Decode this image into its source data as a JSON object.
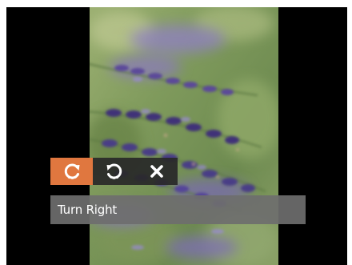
{
  "toolbar": {
    "buttons": [
      {
        "icon": "rotate-right-icon",
        "selected": true
      },
      {
        "icon": "rotate-left-icon",
        "selected": false
      },
      {
        "icon": "close-icon",
        "selected": false
      }
    ]
  },
  "caption": {
    "label": "Turn Right"
  },
  "colors": {
    "selected_button": "#e0773f",
    "toolbar_background": "#282828",
    "caption_background": "#6e6e6e",
    "screen_background": "#000000"
  }
}
